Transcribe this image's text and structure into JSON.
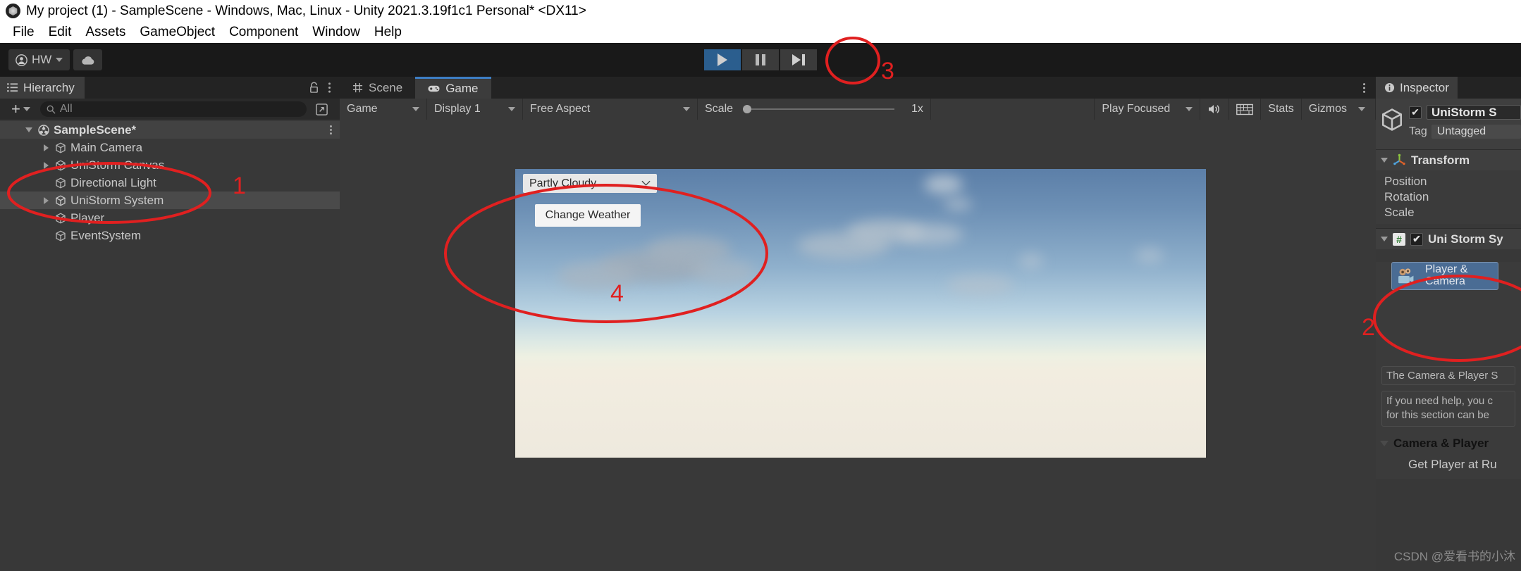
{
  "window": {
    "title": "My project (1) - SampleScene - Windows, Mac, Linux - Unity 2021.3.19f1c1 Personal* <DX11>",
    "logo_icon": "unity-logo-icon"
  },
  "menubar": {
    "items": [
      "File",
      "Edit",
      "Assets",
      "GameObject",
      "Component",
      "Window",
      "Help"
    ]
  },
  "toolbar": {
    "account_label": "HW",
    "account_icon": "person-icon",
    "cloud_icon": "cloud-icon",
    "play_icon": "play-icon",
    "pause_icon": "pause-icon",
    "step_icon": "step-icon"
  },
  "hierarchy": {
    "tab_label": "Hierarchy",
    "tab_icon": "hierarchy-icon",
    "lock_icon": "lock-icon",
    "menu_icon": "kebab-menu-icon",
    "plus_label": "+",
    "search_placeholder": "All",
    "search_icon": "search-icon",
    "expand_icon": "expand-window-icon",
    "items": [
      {
        "label": "SampleScene*",
        "icon": "scene-icon",
        "depth": 0,
        "expanded": true,
        "selected": false,
        "root": true
      },
      {
        "label": "Main Camera",
        "icon": "gameobject-icon",
        "depth": 1,
        "has_arrow": true,
        "selected": false
      },
      {
        "label": "UniStorm Canvas",
        "icon": "gameobject-icon",
        "depth": 1,
        "has_arrow": true,
        "selected": false
      },
      {
        "label": "Directional Light",
        "icon": "gameobject-icon",
        "depth": 1,
        "has_arrow": false,
        "selected": false
      },
      {
        "label": "UniStorm System",
        "icon": "gameobject-icon",
        "depth": 1,
        "has_arrow": true,
        "selected": true
      },
      {
        "label": "Player",
        "icon": "gameobject-icon",
        "depth": 1,
        "has_arrow": false,
        "selected": false
      },
      {
        "label": "EventSystem",
        "icon": "gameobject-icon",
        "depth": 1,
        "has_arrow": false,
        "selected": false
      }
    ]
  },
  "gamepanel": {
    "tabs": [
      {
        "label": "Scene",
        "icon": "scene-grid-icon",
        "selected": false
      },
      {
        "label": "Game",
        "icon": "gamepad-icon",
        "selected": true
      }
    ],
    "menu_icon": "kebab-menu-icon",
    "toolbar": {
      "view_mode": "Game",
      "display": "Display 1",
      "aspect": "Free Aspect",
      "scale_label": "Scale",
      "scale_value": "1x",
      "scale_percent": 0,
      "play_mode": "Play Focused",
      "mute_icon": "speaker-icon",
      "stats_toggle_icon": "keyboard-icon",
      "stats_label": "Stats",
      "gizmos_label": "Gizmos"
    },
    "game_ui": {
      "weather_dropdown_value": "Partly Cloudy",
      "weather_dropdown_icon": "chevron-down-icon",
      "change_weather_button": "Change Weather"
    }
  },
  "inspector": {
    "tab_label": "Inspector",
    "tab_icon": "info-icon",
    "object_name": "UniStorm S",
    "object_icon": "gameobject-icon",
    "enabled_checkbox": true,
    "tag_label": "Tag",
    "tag_value": "Untagged",
    "transform": {
      "title": "Transform",
      "icon": "transform-axis-icon",
      "expanded": true,
      "rows": [
        "Position",
        "Rotation",
        "Scale"
      ]
    },
    "unistorm_component": {
      "title": "Uni Storm Sy",
      "icon": "script-icon",
      "enabled": true,
      "expanded": true,
      "player_camera_button": {
        "line1": "Player &",
        "line2": "Camera",
        "icon": "camera-player-icon"
      },
      "help_text_1": "The Camera & Player S",
      "help_text_2_line1": "If you need help, you c",
      "help_text_2_line2": "for this section can be",
      "section_title": "Camera & Player",
      "section_icon": "chevron-down-icon",
      "sub_row": "Get Player at Ru"
    }
  },
  "annotations": {
    "numbers": [
      "1",
      "2",
      "3",
      "4"
    ],
    "color": "#e02020"
  },
  "watermark": "CSDN @爱看书的小沐",
  "colors": {
    "accent_blue": "#3d7ec4",
    "play_active": "#2b5e8e",
    "panel_bg": "#383838",
    "toolbar_bg": "#191919",
    "annotation_red": "#e02020"
  }
}
